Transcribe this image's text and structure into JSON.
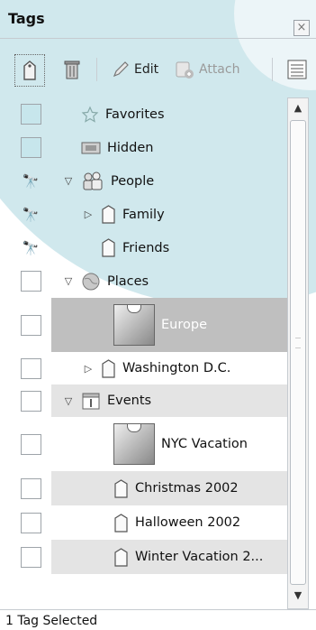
{
  "panel": {
    "title": "Tags",
    "close_glyph": "×"
  },
  "toolbar": {
    "new_tag_icon": "tag-icon",
    "trash_icon": "trash-icon",
    "edit_label": "Edit",
    "attach_label": "Attach",
    "view_icon": "list-view-icon"
  },
  "tags": {
    "favorites": "Favorites",
    "hidden": "Hidden",
    "people": "People",
    "family": "Family",
    "friends": "Friends",
    "places": "Places",
    "europe": "Europe",
    "washington": "Washington D.C.",
    "events": "Events",
    "nyc": "NYC Vacation",
    "christmas": "Christmas 2002",
    "halloween": "Halloween 2002",
    "winter": "Winter Vacation 2..."
  },
  "colors": {
    "accent_blue": "#a9d6df",
    "selected_row": "#bfbfbf"
  },
  "status": {
    "text": "1 Tag Selected"
  }
}
